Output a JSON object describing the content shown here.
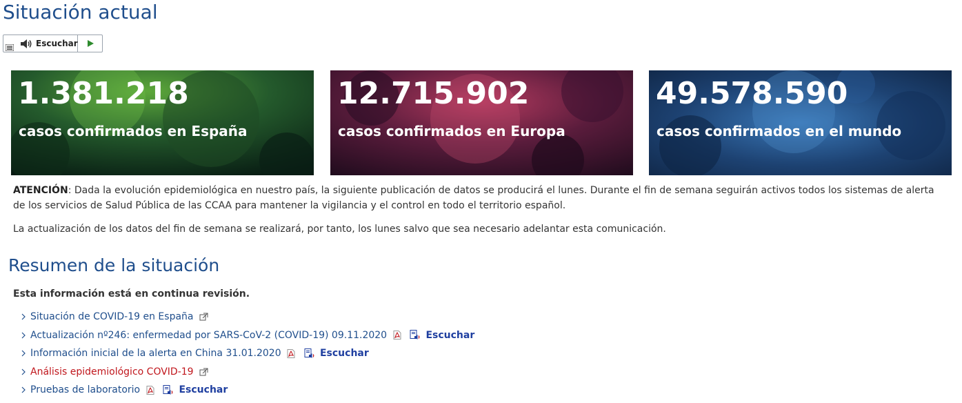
{
  "page": {
    "title": "Situación actual"
  },
  "listen_widget": {
    "label": "Escuchar"
  },
  "stats": [
    {
      "value": "1.381.218",
      "label": "casos confirmados en España",
      "color": "#2f7a2a"
    },
    {
      "value": "12.715.902",
      "label": "casos confirmados en Europa",
      "color": "#8a2450"
    },
    {
      "value": "49.578.590",
      "label": "casos confirmados en el mundo",
      "color": "#1f4f8f"
    }
  ],
  "notice": {
    "lead": "ATENCIÓN",
    "text": ": Dada la evolución epidemiológica en nuestro país, la siguiente publicación de datos se producirá el lunes. Durante el fin de semana seguirán activos todos los sistemas de alerta de los servicios de Salud Pública de las CCAA para mantener la vigilancia y el control en todo el territorio español.",
    "second": "La actualización de los datos del fin de semana se realizará, por tanto, los lunes salvo que sea necesario adelantar esta comunicación."
  },
  "summary": {
    "title": "Resumen de la situación",
    "review_note": "Esta información está en continua revisión.",
    "listen_label": "Escuchar",
    "links": [
      {
        "text": "Situación de COVID-19 en España"
      },
      {
        "text": "Actualización nº246: enfermedad por SARS-CoV-2 (COVID-19) 09.11.2020"
      },
      {
        "text": "Información inicial de la alerta en China 31.01.2020"
      },
      {
        "text": "Análisis epidemiológico COVID-19"
      },
      {
        "text": "Pruebas de laboratorio"
      }
    ]
  }
}
